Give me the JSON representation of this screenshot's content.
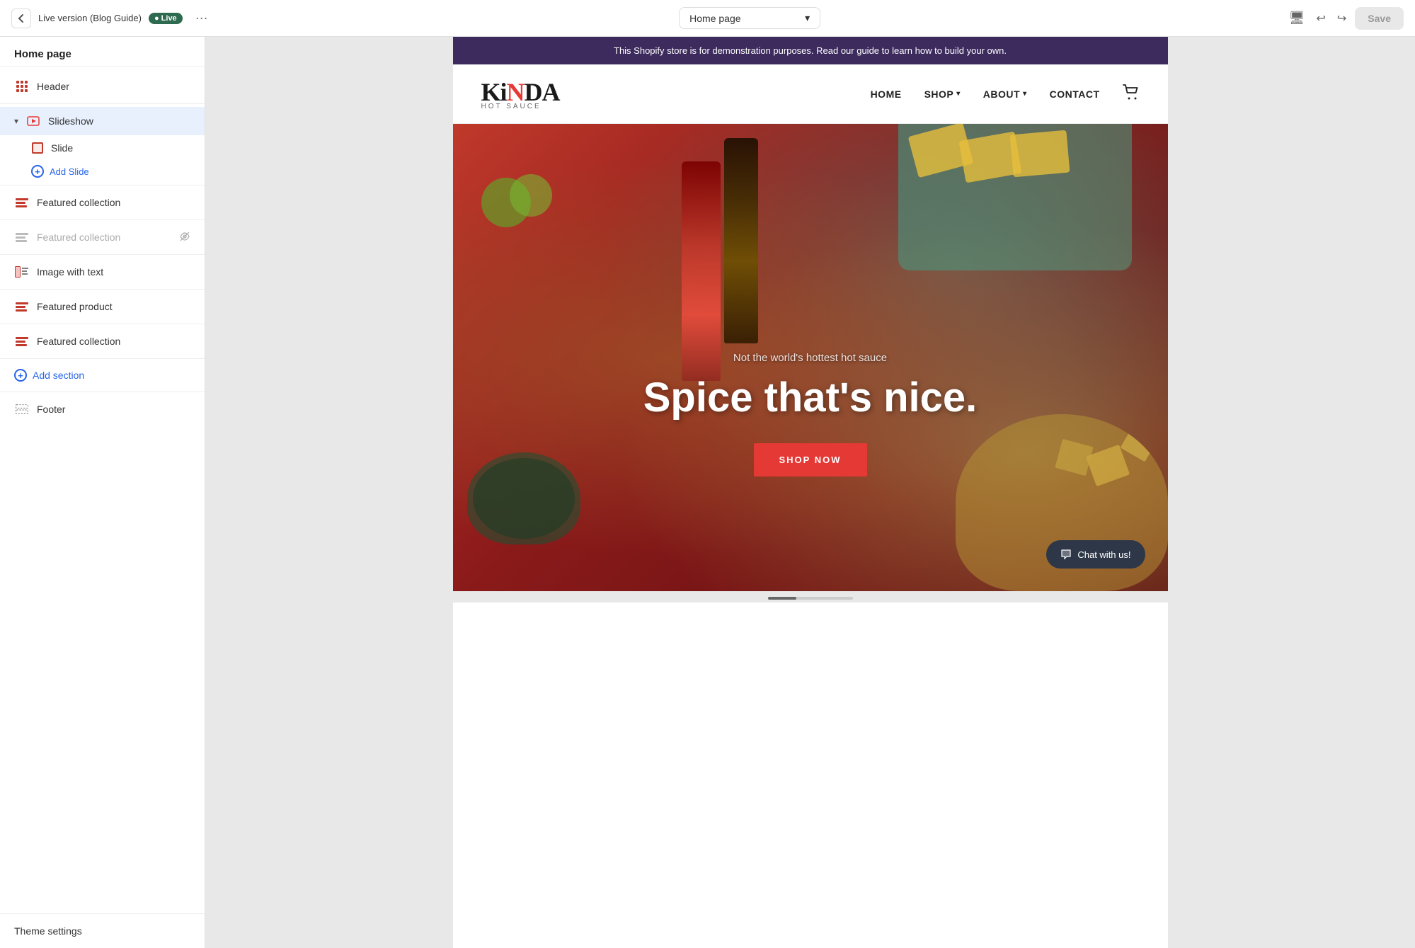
{
  "toolbar": {
    "back_label": "←",
    "version": "Live version (Blog Guide)",
    "live_badge": "● Live",
    "more": "···",
    "page_selector": "Home page",
    "chevron": "▾",
    "device_icon": "🖥",
    "undo": "↩",
    "redo": "↪",
    "save": "Save"
  },
  "sidebar": {
    "title": "Home page",
    "items": [
      {
        "id": "header",
        "label": "Header",
        "icon": "grid"
      },
      {
        "id": "slideshow",
        "label": "Slideshow",
        "icon": "grid",
        "expanded": true
      },
      {
        "id": "slide",
        "label": "Slide",
        "icon": "slide",
        "sub": true
      },
      {
        "id": "add-slide",
        "label": "Add Slide",
        "sub": true,
        "add": true
      },
      {
        "id": "featured-collection-1",
        "label": "Featured collection",
        "icon": "bars"
      },
      {
        "id": "featured-collection-2",
        "label": "Featured collection",
        "icon": "bars",
        "hidden": true
      },
      {
        "id": "image-with-text",
        "label": "Image with text",
        "icon": "imgtext"
      },
      {
        "id": "featured-product",
        "label": "Featured product",
        "icon": "bars"
      },
      {
        "id": "featured-collection-3",
        "label": "Featured collection",
        "icon": "bars"
      }
    ],
    "add_section": "Add section",
    "footer": "Theme settings"
  },
  "announcement": {
    "text": "This Shopify store is for demonstration purposes. Read our guide to learn how to build your own."
  },
  "store": {
    "logo_main": "KiNDA",
    "logo_sub": "HOT SAUCE",
    "nav": [
      {
        "label": "HOME",
        "dropdown": false
      },
      {
        "label": "SHOP",
        "dropdown": true
      },
      {
        "label": "ABOUT",
        "dropdown": true
      },
      {
        "label": "CONTACT",
        "dropdown": false
      }
    ]
  },
  "hero": {
    "subtitle": "Not the world's hottest hot sauce",
    "title": "Spice that's nice.",
    "cta": "SHOP NOW"
  },
  "chat": {
    "label": "Chat with us!"
  },
  "colors": {
    "live_green": "#2d6a4f",
    "accent_red": "#e53935",
    "sidebar_bg": "#ffffff",
    "announcement_bg": "#3d2b5e",
    "hero_btn": "#e53935",
    "chat_bg": "#2d3748",
    "add_blue": "#2563eb"
  }
}
